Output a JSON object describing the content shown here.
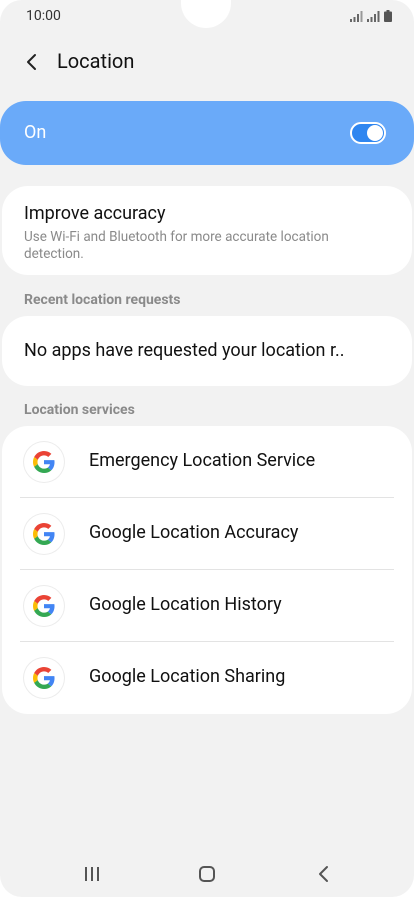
{
  "status_bar": {
    "time": "10:00"
  },
  "header": {
    "title": "Location"
  },
  "master_switch": {
    "label": "On",
    "state": "on"
  },
  "improve_accuracy": {
    "title": "Improve accuracy",
    "summary": "Use Wi-Fi and Bluetooth for more accurate location detection."
  },
  "recent_requests": {
    "header": "Recent location requests",
    "empty_text": "No apps have requested your location r.."
  },
  "location_services": {
    "header": "Location services",
    "items": [
      {
        "label": "Emergency Location Service",
        "icon": "google-icon"
      },
      {
        "label": "Google Location Accuracy",
        "icon": "google-icon"
      },
      {
        "label": "Google Location History",
        "icon": "google-icon"
      },
      {
        "label": "Google Location Sharing",
        "icon": "google-icon"
      }
    ]
  },
  "colors": {
    "accent": "#2f86f0",
    "toggle_banner": "#6aaaf9",
    "background": "#f2f2f2"
  }
}
